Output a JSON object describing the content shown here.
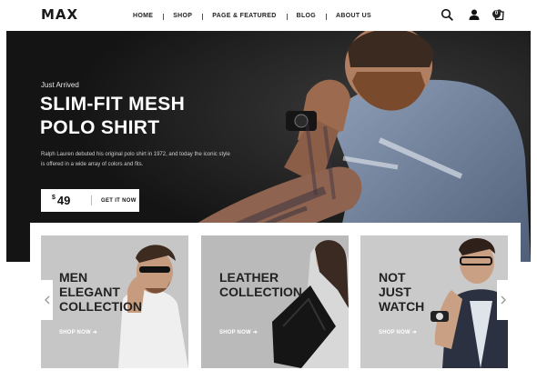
{
  "header": {
    "logo": "MAX",
    "nav": [
      "HOME",
      "SHOP",
      "PAGE & FEATURED",
      "BLOG",
      "ABOUT US"
    ],
    "cart_count": "0",
    "icons": [
      "search-icon",
      "user-icon",
      "cart-icon"
    ]
  },
  "hero": {
    "kicker": "Just Arrived",
    "title_line1": "SLIM-FIT MESH",
    "title_line2": "POLO SHIRT",
    "description": "Ralph Lauren debuted his original polo shirt in 1972, and today the iconic style is offered in a wide array of colors and fits.",
    "price_currency": "$",
    "price_value": "49",
    "cta": "GET IT NOW"
  },
  "categories": [
    {
      "line1": "MEN",
      "line2": "ELEGANT",
      "line3": "COLLECTION",
      "cta": "SHOP NOW"
    },
    {
      "line1": "LEATHER",
      "line2": "COLLECTION",
      "line3": "",
      "cta": "SHOP NOW"
    },
    {
      "line1": "NOT",
      "line2": "JUST",
      "line3": "WATCH",
      "cta": "SHOP NOW"
    }
  ],
  "colors": {
    "hero_bg": "#1b1b1b",
    "text_dark": "#222222",
    "white": "#ffffff"
  }
}
